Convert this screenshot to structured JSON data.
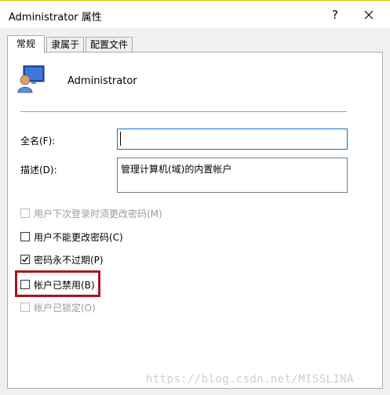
{
  "window": {
    "title": "Administrator 属性",
    "help_glyph": "?"
  },
  "tabs": [
    {
      "label": "常规",
      "active": true
    },
    {
      "label": "隶属于",
      "active": false
    },
    {
      "label": "配置文件",
      "active": false
    }
  ],
  "general": {
    "username": "Administrator",
    "fullname_label": "全名(F):",
    "fullname_value": "",
    "description_label": "描述(D):",
    "description_value": "管理计算机(域)的内置帐户",
    "options": [
      {
        "label": "用户下次登录时须更改密码(M)",
        "checked": false,
        "enabled": false
      },
      {
        "label": "用户不能更改密码(C)",
        "checked": false,
        "enabled": true
      },
      {
        "label": "密码永不过期(P)",
        "checked": true,
        "enabled": true
      },
      {
        "label": "帐户已禁用(B)",
        "checked": false,
        "enabled": true
      },
      {
        "label": "帐户已锁定(O)",
        "checked": false,
        "enabled": false
      }
    ]
  },
  "watermark": "https://blog.csdn.net/MISSLINA",
  "colors": {
    "highlight_border": "#b0101f",
    "focus_border": "#0078d7"
  }
}
